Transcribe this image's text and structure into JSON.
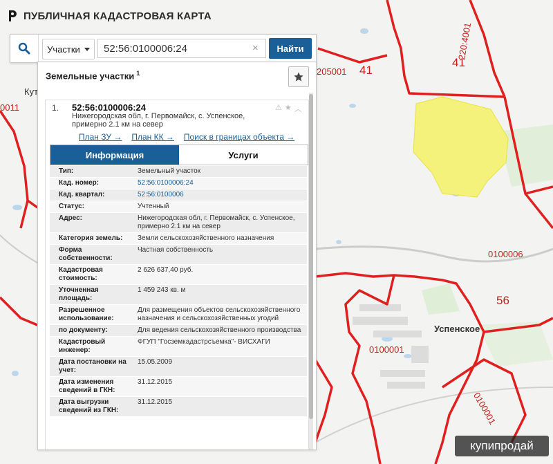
{
  "header": {
    "title": "ПУБЛИЧНАЯ КАДАСТРОВАЯ КАРТА"
  },
  "search": {
    "type_label": "Участки",
    "value": "52:56:0100006:24",
    "clear_icon": "×",
    "find_label": "Найти"
  },
  "panel": {
    "title": "Земельные участки",
    "count": "1"
  },
  "parcel": {
    "index": "1.",
    "number": "52:56:0100006:24",
    "address": "Нижегородская обл, г. Первомайск, с. Успенское, примерно 2.1 км на север",
    "links": [
      "План ЗУ →",
      "План КК →",
      "Поиск в границах объекта →"
    ]
  },
  "tabs": [
    "Информация",
    "Услуги"
  ],
  "info_rows": [
    {
      "key": "Тип:",
      "value": "Земельный участок"
    },
    {
      "key": "Кад. номер:",
      "value": "52:56:0100006:24"
    },
    {
      "key": "Кад. квартал:",
      "value": "52:56:0100006"
    },
    {
      "key": "Статус:",
      "value": "Учтенный"
    },
    {
      "key": "Адрес:",
      "value": "Нижегородская обл, г. Первомайск, с. Успенское, примерно 2.1 км на север"
    },
    {
      "key": "Категория земель:",
      "value": "Земли сельскохозяйственного назначения"
    },
    {
      "key": "Форма собственности:",
      "value": "Частная собственность"
    },
    {
      "key": "Кадастровая стоимость:",
      "value": "2 626 637,40 руб."
    },
    {
      "key": "Уточненная площадь:",
      "value": "1 459 243 кв. м"
    },
    {
      "key": "Разрешенное использование:",
      "value": "Для размещения объектов сельскохозяйственного назначения и сельскохозяйственных угодий"
    },
    {
      "key": "по документу:",
      "value": "Для ведения сельскохозяйственного производства"
    },
    {
      "key": "Кадастровый инженер:",
      "value": "ФГУП \"Госземкадастрсъемка\"- ВИСХАГИ"
    },
    {
      "key": "Дата постановки на учет:",
      "value": "15.05.2009"
    },
    {
      "key": "Дата изменения сведений в ГКН:",
      "value": "31.12.2015"
    },
    {
      "key": "Дата выгрузки сведений из ГКН:",
      "value": "31.12.2015"
    }
  ],
  "map": {
    "labels": [
      "205001",
      "41",
      "41",
      "220:4001",
      "0100006",
      "56",
      "0100001",
      "0100001",
      "0011",
      "Куту"
    ],
    "town": "Успенское"
  },
  "watermark": "купипродай",
  "colors": {
    "accent": "#1a5f97",
    "boundary": "#e01f1f",
    "parcel_fill": "#f4f27a"
  }
}
